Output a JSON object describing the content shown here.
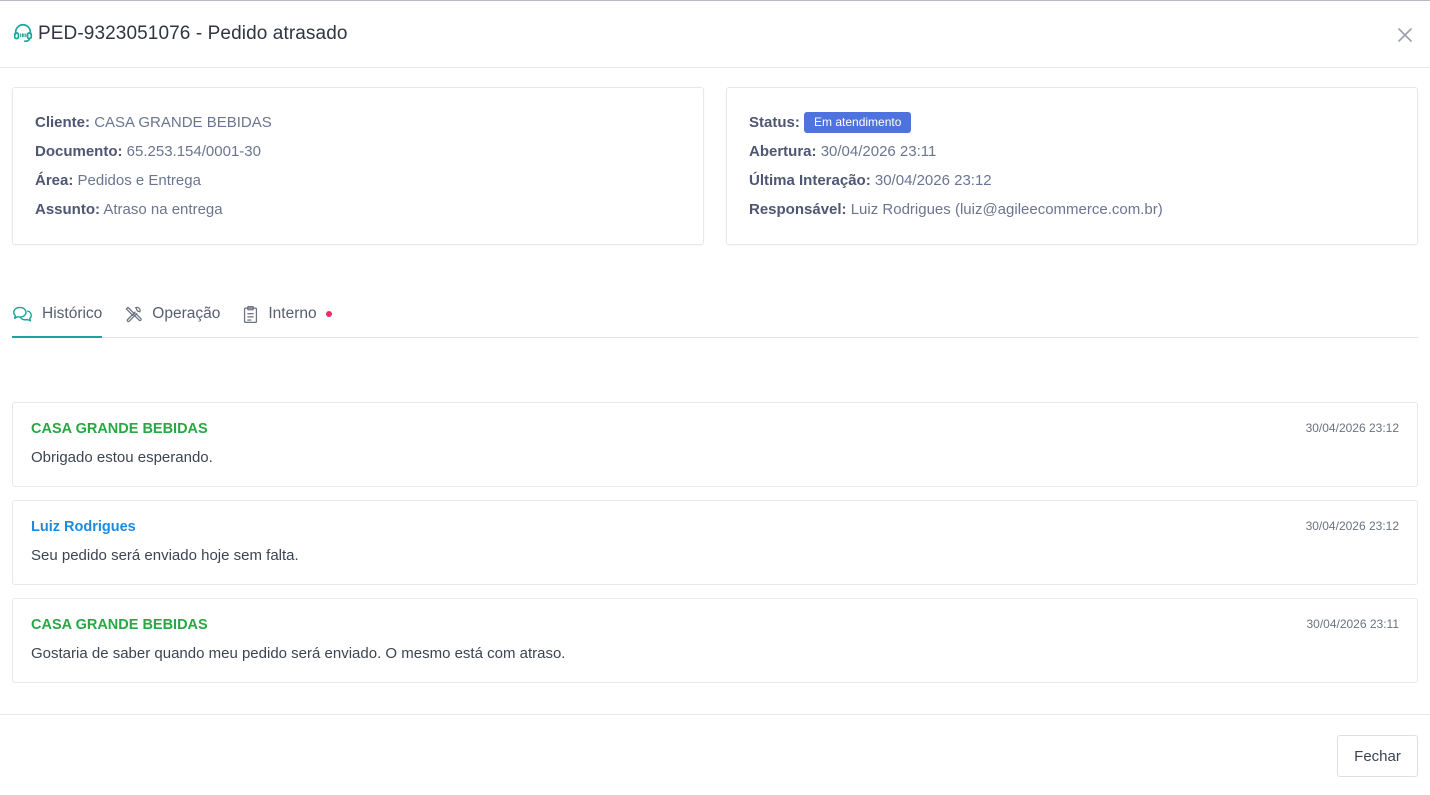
{
  "modal": {
    "title": "PED-9323051076 - Pedido atrasado",
    "colors": {
      "accent": "#1ba39c",
      "badge": "#4e73df",
      "client": "#28a745",
      "agent": "#1a8be0",
      "notify_dot": "#ef2d5e"
    }
  },
  "info_left": {
    "cliente_label": "Cliente:",
    "cliente": "CASA GRANDE BEBIDAS",
    "documento_label": "Documento:",
    "documento": "65.253.154/0001-30",
    "area_label": "Área:",
    "area": "Pedidos e Entrega",
    "assunto_label": "Assunto:",
    "assunto": "Atraso na entrega"
  },
  "info_right": {
    "status_label": "Status:",
    "status": "Em atendimento",
    "abertura_label": "Abertura:",
    "abertura": "30/04/2026 23:11",
    "ultima_label": "Última Interação:",
    "ultima": "30/04/2026 23:12",
    "responsavel_label": "Responsável:",
    "responsavel": "Luiz Rodrigues (luiz@agileecommerce.com.br)"
  },
  "tabs": [
    {
      "label": "Histórico",
      "icon": "chat-bubbles-icon",
      "active": true
    },
    {
      "label": "Operação",
      "icon": "tools-icon",
      "active": false
    },
    {
      "label": "Interno",
      "icon": "clipboard-icon",
      "active": false,
      "has_notification": true
    }
  ],
  "messages": [
    {
      "author": "CASA GRANDE BEBIDAS",
      "role": "client",
      "time": "30/04/2026 23:12",
      "text": "Obrigado estou esperando."
    },
    {
      "author": "Luiz Rodrigues",
      "role": "agent",
      "time": "30/04/2026 23:12",
      "text": "Seu pedido será enviado hoje sem falta."
    },
    {
      "author": "CASA GRANDE BEBIDAS",
      "role": "client",
      "time": "30/04/2026 23:11",
      "text": "Gostaria de saber quando meu pedido será enviado. O mesmo está com atraso."
    }
  ],
  "footer": {
    "close_label": "Fechar"
  }
}
